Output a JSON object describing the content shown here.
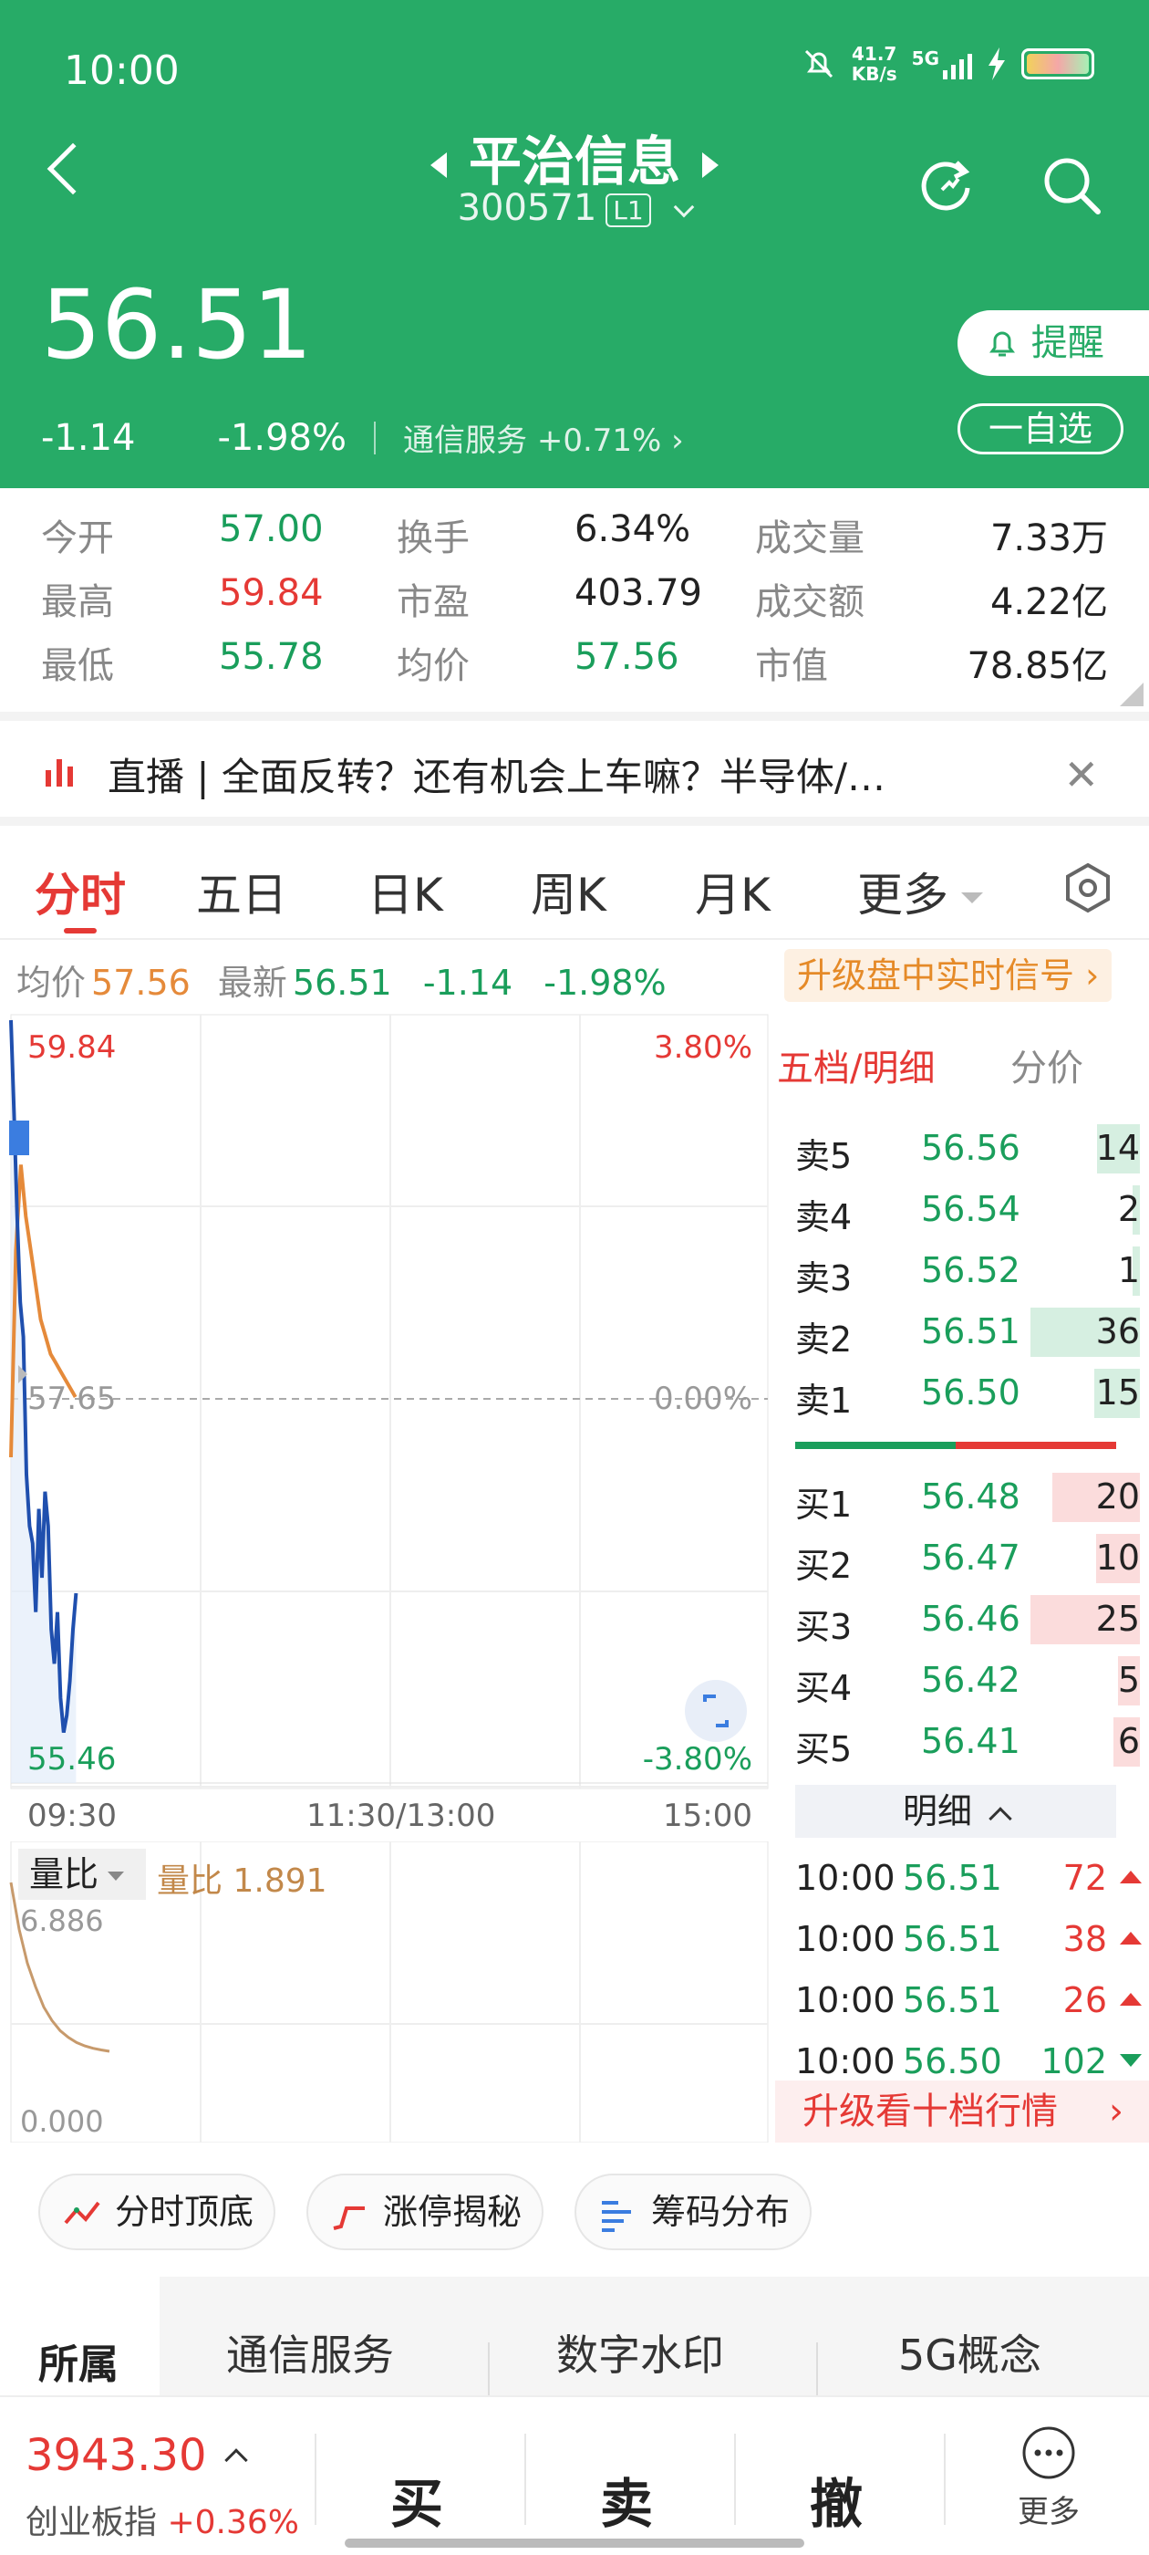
{
  "status_bar": {
    "time": "10:00",
    "speed_value": "41.7",
    "speed_unit": "KB/s",
    "network": "5G"
  },
  "header": {
    "stock_name": "平治信息",
    "stock_code": "300571",
    "level": "L1",
    "price": "56.51",
    "change": "-1.14",
    "change_pct": "-1.98%",
    "sector_name": "通信服务",
    "sector_change": "+0.71%",
    "remind_label": "提醒",
    "favorite_label": "一自选"
  },
  "stats": {
    "open_label": "今开",
    "open": "57.00",
    "high_label": "最高",
    "high": "59.84",
    "low_label": "最低",
    "low": "55.78",
    "turnover_label": "换手",
    "turnover": "6.34%",
    "pe_label": "市盈",
    "pe": "403.79",
    "avg_label": "均价",
    "avg": "57.56",
    "volume_label": "成交量",
    "volume": "7.33万",
    "amount_label": "成交额",
    "amount": "4.22亿",
    "mktcap_label": "市值",
    "mktcap": "78.85亿"
  },
  "live": {
    "text": "直播 | 全面反转？还有机会上车嘛？半导体/…"
  },
  "tabs": {
    "t1": "分时",
    "t2": "五日",
    "t3": "日K",
    "t4": "周K",
    "t5": "月K",
    "t6": "更多"
  },
  "infoline": {
    "avg_label": "均价",
    "avg": "57.56",
    "latest_label": "最新",
    "latest": "56.51",
    "chg": "-1.14",
    "pct": "-1.98%",
    "upgrade": "升级盘中实时信号"
  },
  "chart": {
    "y_high": "59.84",
    "y_mid": "57.65",
    "y_low": "55.46",
    "pct_high": "3.80%",
    "pct_mid": "0.00%",
    "pct_low": "-3.80%",
    "t_start": "09:30",
    "t_mid": "11:30/13:00",
    "t_end": "15:00",
    "vol_tab": "量比",
    "vol_label": "量比",
    "vol_value": "1.891",
    "vol_max": "6.886",
    "vol_min": "0.000"
  },
  "chart_data": {
    "type": "line",
    "y_range": [
      55.46,
      59.84
    ],
    "reference": 57.65,
    "series": [
      {
        "name": "价格",
        "color": "#1f4fae",
        "values": [
          59.84,
          59.3,
          58.7,
          58.2,
          58.0,
          57.2,
          56.9,
          56.8,
          56.4,
          57.0,
          56.6,
          57.1,
          56.9,
          56.3,
          56.1,
          56.4,
          55.9,
          55.7,
          55.8,
          56.0,
          56.3,
          56.51
        ]
      },
      {
        "name": "均价",
        "color": "#e58a3a",
        "values": [
          57.3,
          58.5,
          59.0,
          58.7,
          58.5,
          58.3,
          58.1,
          58.0,
          57.9,
          57.85,
          57.8,
          57.75,
          57.7,
          57.65
        ]
      }
    ],
    "volume_ratio": [
      6.886,
      5.5,
      4.5,
      3.8,
      3.2,
      2.8,
      2.5,
      2.3,
      2.15,
      2.05,
      1.98,
      1.93,
      1.891
    ]
  },
  "orderbook": {
    "tab1": "五档/明细",
    "tab2": "分价",
    "asks": [
      {
        "name": "卖5",
        "price": "56.56",
        "qty": "14",
        "ratio": 0.39
      },
      {
        "name": "卖4",
        "price": "56.54",
        "qty": "2",
        "ratio": 0.06
      },
      {
        "name": "卖3",
        "price": "56.52",
        "qty": "1",
        "ratio": 0.03
      },
      {
        "name": "卖2",
        "price": "56.51",
        "qty": "36",
        "ratio": 1.0
      },
      {
        "name": "卖1",
        "price": "56.50",
        "qty": "15",
        "ratio": 0.42
      }
    ],
    "bids": [
      {
        "name": "买1",
        "price": "56.48",
        "qty": "20",
        "ratio": 0.8
      },
      {
        "name": "买2",
        "price": "56.47",
        "qty": "10",
        "ratio": 0.4
      },
      {
        "name": "买3",
        "price": "56.46",
        "qty": "25",
        "ratio": 1.0
      },
      {
        "name": "买4",
        "price": "56.42",
        "qty": "5",
        "ratio": 0.2
      },
      {
        "name": "买5",
        "price": "56.41",
        "qty": "6",
        "ratio": 0.24
      }
    ],
    "detail_label": "明细",
    "details": [
      {
        "time": "10:00",
        "price": "56.51",
        "vol": "72",
        "dir": "up"
      },
      {
        "time": "10:00",
        "price": "56.51",
        "vol": "38",
        "dir": "up"
      },
      {
        "time": "10:00",
        "price": "56.51",
        "vol": "26",
        "dir": "up"
      },
      {
        "time": "10:00",
        "price": "56.50",
        "vol": "102",
        "dir": "down"
      }
    ],
    "upgrade_ten": "升级看十档行情"
  },
  "quick": {
    "b1": "分时顶底",
    "b2": "涨停揭秘",
    "b3": "筹码分布"
  },
  "concepts": {
    "c0": "所属",
    "c1": "通信服务",
    "c2": "数字水印",
    "c3": "5G概念"
  },
  "bottom": {
    "index_value": "3943.30",
    "index_name": "创业板指",
    "index_change": "+0.36%",
    "buy": "买",
    "sell": "卖",
    "cancel": "撤",
    "more": "更多"
  },
  "colors": {
    "brand_green": "#27ab67",
    "up_red": "#e53935",
    "down_green": "#1a9e5b",
    "price_line": "#1f4fae",
    "avg_line": "#e58a3a"
  }
}
